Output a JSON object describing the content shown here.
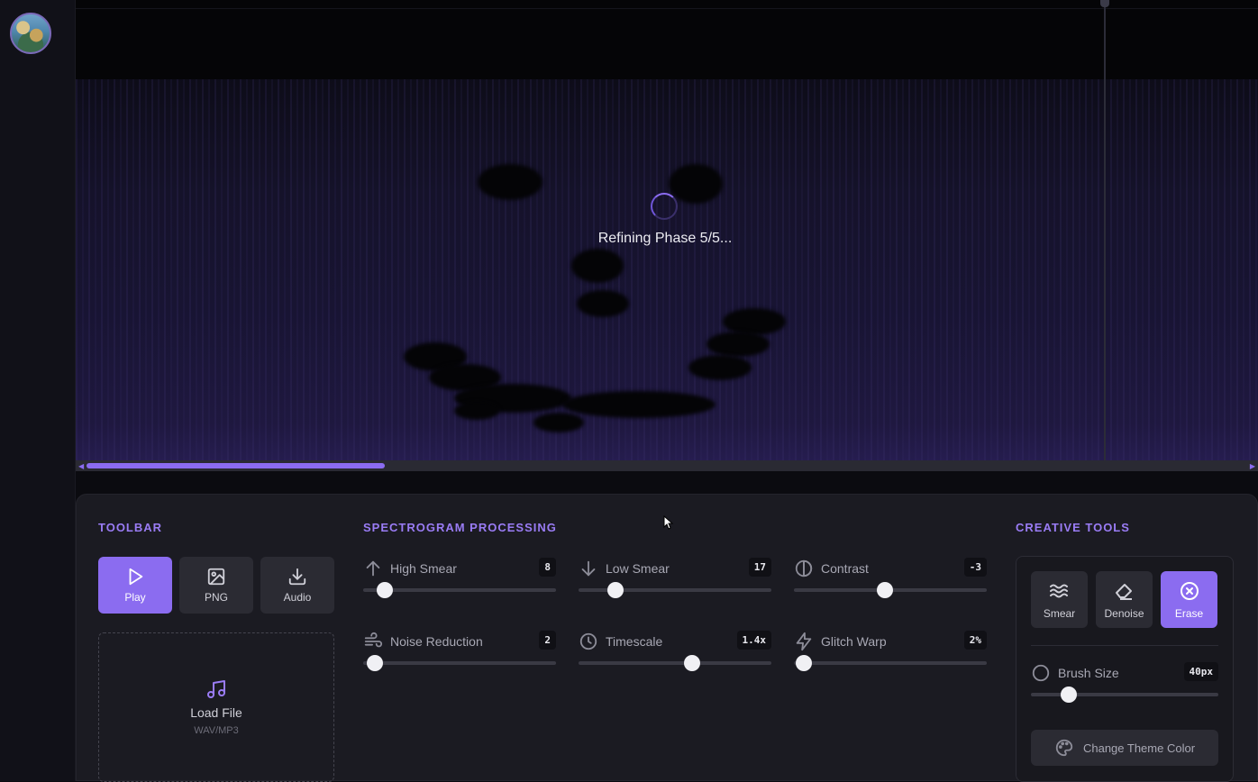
{
  "spectrogram": {
    "status_text": "Refining Phase 5/5..."
  },
  "toolbar": {
    "title": "TOOLBAR",
    "buttons": [
      {
        "label": "Play",
        "icon": "play-icon",
        "active": true
      },
      {
        "label": "PNG",
        "icon": "image-icon",
        "active": false
      },
      {
        "label": "Audio",
        "icon": "download-icon",
        "active": false
      }
    ],
    "load": {
      "title": "Load File",
      "subtitle": "WAV/MP3",
      "icon": "music-note-icon"
    }
  },
  "processing": {
    "title": "SPECTROGRAM PROCESSING",
    "sliders": [
      {
        "label": "High Smear",
        "value": "8",
        "icon": "arrow-up-icon",
        "level": 0.11
      },
      {
        "label": "Low Smear",
        "value": "17",
        "icon": "arrow-down-icon",
        "level": 0.19
      },
      {
        "label": "Contrast",
        "value": "-3",
        "icon": "contrast-icon",
        "level": 0.47
      },
      {
        "label": "Noise Reduction",
        "value": "2",
        "icon": "wind-icon",
        "level": 0.06
      },
      {
        "label": "Timescale",
        "value": "1.4x",
        "icon": "clock-icon",
        "level": 0.59
      },
      {
        "label": "Glitch Warp",
        "value": "2%",
        "icon": "lightning-icon",
        "level": 0.05
      }
    ]
  },
  "creative": {
    "title": "CREATIVE TOOLS",
    "tools": [
      {
        "label": "Smear",
        "icon": "waves-icon",
        "active": false
      },
      {
        "label": "Denoise",
        "icon": "eraser-icon",
        "active": false
      },
      {
        "label": "Erase",
        "icon": "x-circle-icon",
        "active": true
      }
    ],
    "brush": {
      "label": "Brush Size",
      "value": "40px",
      "level": 0.2
    },
    "theme_button": "Change Theme Color"
  },
  "colors": {
    "accent": "#8b6cf0",
    "panel": "#1b1b22",
    "background": "#0b0b10"
  }
}
